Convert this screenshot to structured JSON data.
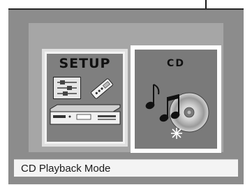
{
  "menu": {
    "items": [
      {
        "label": "SETUP",
        "icon": "settings-sliders-icon"
      },
      {
        "label": "CD",
        "icon": "music-disc-icon"
      }
    ],
    "selected": "CD"
  },
  "status": {
    "text": "CD Playback Mode"
  },
  "colors": {
    "screen_bg": "#8c8c8c",
    "panel_bg": "#a6a6a6",
    "selected_frame": "#ffffff",
    "status_bg": "#f4f4f4"
  }
}
